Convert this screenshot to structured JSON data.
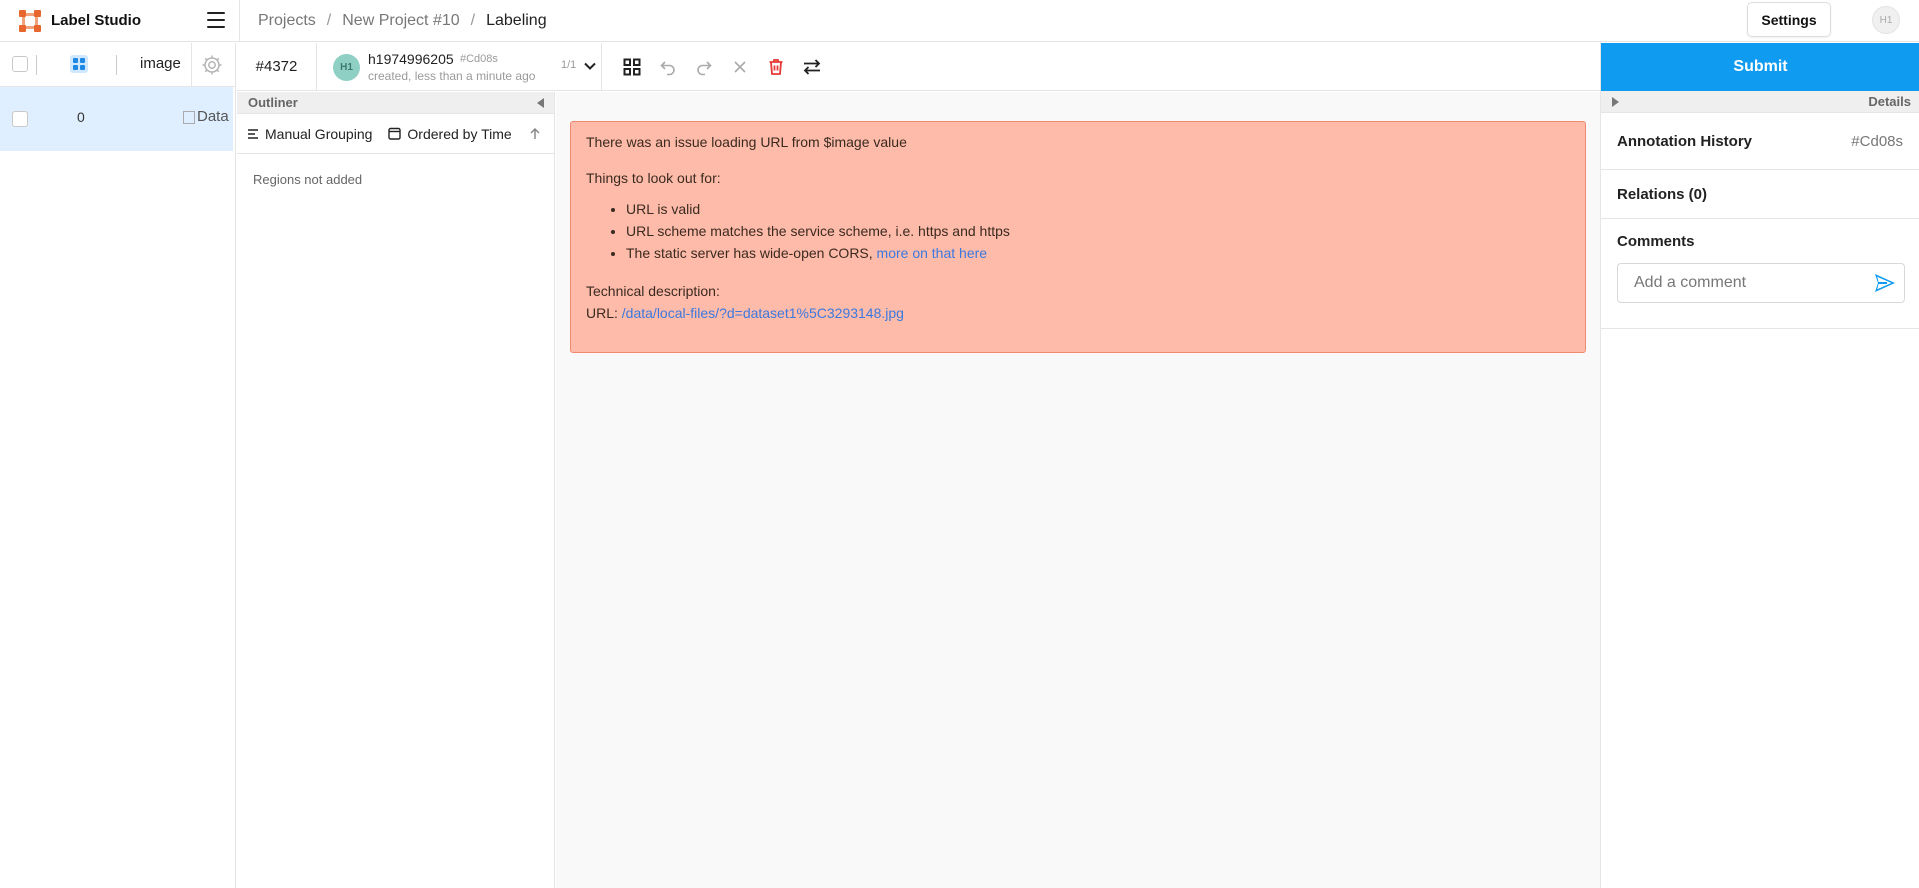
{
  "app": {
    "name": "Label Studio"
  },
  "breadcrumb": [
    "Projects",
    "New Project #10",
    "Labeling"
  ],
  "header": {
    "settings_label": "Settings",
    "user_initials": "H1"
  },
  "tasklist": {
    "column_image": "image",
    "rows": [
      {
        "id": "0",
        "image_alt": "Data"
      }
    ]
  },
  "toolbar": {
    "task_id": "#4372",
    "annotator": {
      "initials": "H1",
      "name": "h1974996205",
      "annotation_hash": "#Cd08s",
      "created": "created, less than a minute ago",
      "count": "1/1"
    },
    "tool_icons": [
      "grid-view-icon",
      "undo-icon",
      "redo-icon",
      "reset-icon",
      "delete-icon",
      "swap-icon"
    ]
  },
  "outliner": {
    "title": "Outliner",
    "grouping_label": "Manual Grouping",
    "ordering_label": "Ordered by Time",
    "empty_text": "Regions not added"
  },
  "error": {
    "title": "There was an issue loading URL from $image value",
    "lookout": "Things to look out for:",
    "items": [
      "URL is valid",
      "URL scheme matches the service scheme, i.e. https and https",
      "The static server has wide-open CORS, "
    ],
    "cors_link": "more on that here",
    "tech_title": "Technical description:",
    "url_label": "URL: ",
    "url_value": "/data/local-files/?d=dataset1%5C3293148.jpg"
  },
  "right": {
    "submit_label": "Submit",
    "details_title": "Details",
    "history_title": "Annotation History",
    "history_id": "#Cd08s",
    "relations_title": "Relations (0)",
    "comments_title": "Comments",
    "comment_placeholder": "Add a comment"
  },
  "colors": {
    "accent": "#0f9bf0",
    "error_bg": "#ffbba9",
    "brand": "#e8672f",
    "delete": "#e53935"
  }
}
